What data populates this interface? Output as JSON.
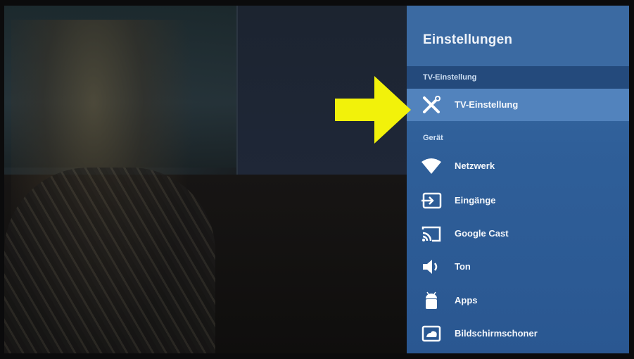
{
  "settings_panel": {
    "title": "Einstellungen",
    "section_tv": "TV-Einstellung",
    "section_device": "Gerät",
    "items": [
      {
        "label": "TV-Einstellung",
        "icon": "tools-icon",
        "selected": true
      },
      {
        "label": "Netzwerk",
        "icon": "wifi-icon"
      },
      {
        "label": "Eingänge",
        "icon": "input-icon"
      },
      {
        "label": "Google Cast",
        "icon": "cast-icon"
      },
      {
        "label": "Ton",
        "icon": "speaker-icon"
      },
      {
        "label": "Apps",
        "icon": "android-icon"
      },
      {
        "label": "Bildschirmschoner",
        "icon": "screensaver-icon"
      }
    ]
  },
  "colors": {
    "panel": "#2f5f99",
    "panel_header": "#3b6aa2",
    "selected": "#5283bd",
    "arrow": "#f2f20a"
  }
}
